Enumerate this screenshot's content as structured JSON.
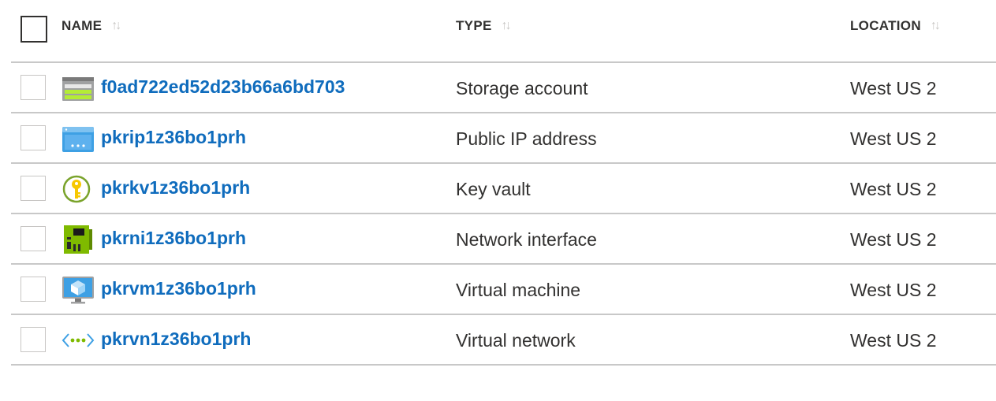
{
  "columns": {
    "name": "NAME",
    "type": "TYPE",
    "location": "LOCATION",
    "sort_glyph": "↑↓"
  },
  "rows": [
    {
      "name": "f0ad722ed52d23b66a6bd703",
      "type": "Storage account",
      "location": "West US 2",
      "icon": "storage-account-icon"
    },
    {
      "name": "pkrip1z36bo1prh",
      "type": "Public IP address",
      "location": "West US 2",
      "icon": "public-ip-icon"
    },
    {
      "name": "pkrkv1z36bo1prh",
      "type": "Key vault",
      "location": "West US 2",
      "icon": "key-vault-icon"
    },
    {
      "name": "pkrni1z36bo1prh",
      "type": "Network interface",
      "location": "West US 2",
      "icon": "network-interface-icon"
    },
    {
      "name": "pkrvm1z36bo1prh",
      "type": "Virtual machine",
      "location": "West US 2",
      "icon": "virtual-machine-icon"
    },
    {
      "name": "pkrvn1z36bo1prh",
      "type": "Virtual network",
      "location": "West US 2",
      "icon": "virtual-network-icon"
    }
  ],
  "colors": {
    "link": "#0f6cbd",
    "divider": "#c8c8c8"
  }
}
